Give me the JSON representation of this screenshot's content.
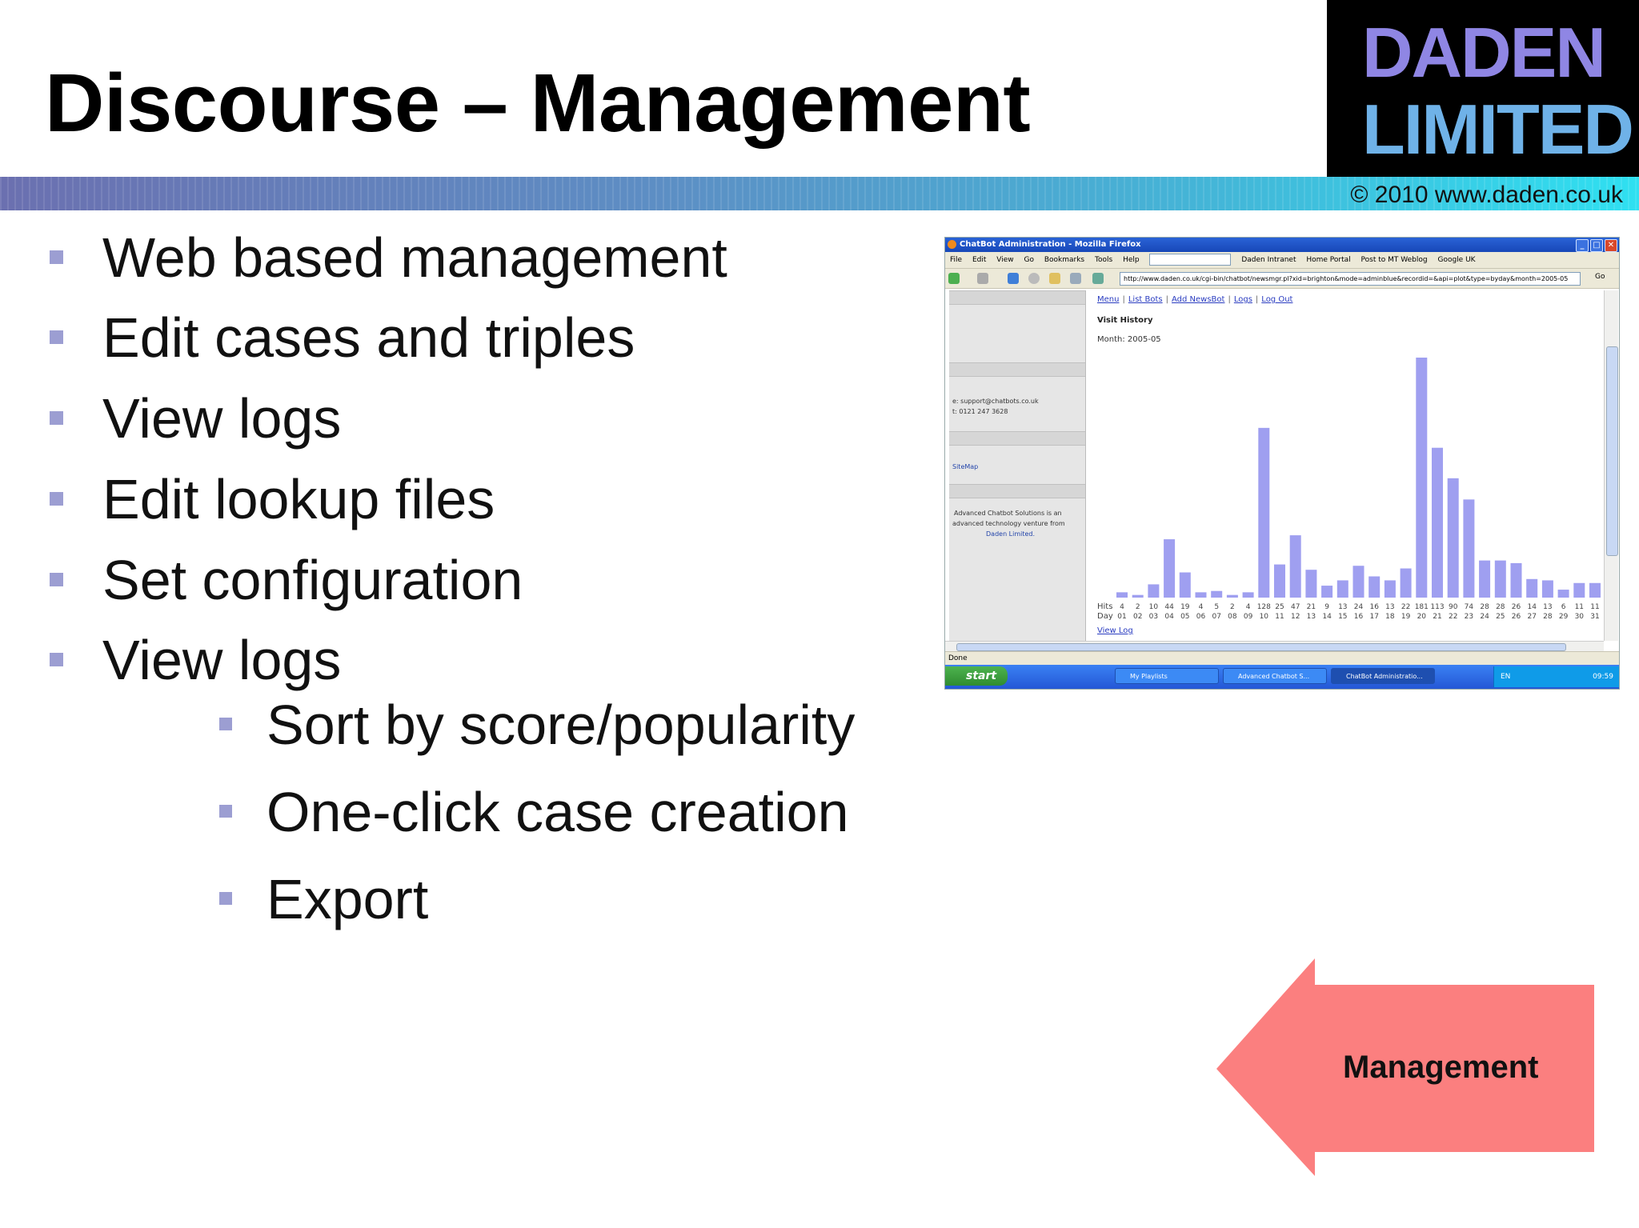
{
  "slide": {
    "title": "Discourse – Management",
    "logo": {
      "line1": "DADEN",
      "line2": "LIMITED"
    },
    "copyright": "© 2010 www.daden.co.uk",
    "bullets": [
      "Web based management",
      "Edit cases and triples",
      "View logs",
      "Edit lookup files",
      "Set configuration",
      "View logs"
    ],
    "sub_bullets": [
      "Sort by score/popularity",
      "One-click case creation",
      "Export"
    ],
    "arrow_label": "Management",
    "colors": {
      "bullet": "#9c9ed2",
      "arrow": "#fb7f7f",
      "logo_top": "#8f86e4",
      "logo_bottom": "#6fb2e8"
    }
  },
  "screenshot": {
    "window_title": "ChatBot Administration - Mozilla Firefox",
    "menu": [
      "File",
      "Edit",
      "View",
      "Go",
      "Bookmarks",
      "Tools",
      "Help"
    ],
    "bookmarks": [
      "Daden Intranet",
      "Home Portal",
      "Post to MT Weblog",
      "Google UK"
    ],
    "url": "http://www.daden.co.uk/cgi-bin/chatbot/newsmgr.pl?xid=brighton&mode=adminblue&recordid=&api=plot&type=byday&month=2005-05",
    "go_label": "Go",
    "sidebar": {
      "email": "e: support@chatbots.co.uk",
      "phone": "t: 0121 247 3628",
      "sitemap": "SiteMap",
      "about_1": "Advanced Chatbot Solutions is an",
      "about_2": "advanced technology venture from",
      "about_3": "Daden Limited."
    },
    "nav_links": [
      "Menu",
      "List Bots",
      "Add NewsBot",
      "Logs",
      "Log Out"
    ],
    "heading": "Visit History",
    "month_label": "Month: 2005-05",
    "view_log": "View Log",
    "status": "Done",
    "taskbar": {
      "start": "start",
      "tasks": [
        "My Playlists",
        "Advanced Chatbot S...",
        "ChatBot Administratio..."
      ],
      "lang": "EN",
      "clock": "09:59"
    }
  },
  "chart_data": {
    "type": "bar",
    "title": "Visit History",
    "row_labels": [
      "Hits",
      "Day"
    ],
    "categories": [
      "01",
      "02",
      "03",
      "04",
      "05",
      "06",
      "07",
      "08",
      "09",
      "10",
      "11",
      "12",
      "13",
      "14",
      "15",
      "16",
      "17",
      "18",
      "19",
      "20",
      "21",
      "22",
      "23",
      "24",
      "25",
      "26",
      "27",
      "28",
      "29",
      "30",
      "31"
    ],
    "values": [
      4,
      2,
      10,
      44,
      19,
      4,
      5,
      2,
      4,
      128,
      25,
      47,
      21,
      9,
      13,
      24,
      16,
      13,
      22,
      181,
      113,
      90,
      74,
      28,
      28,
      26,
      14,
      13,
      6,
      11,
      11
    ],
    "bar_color": "#9f9ff0",
    "grid": false
  }
}
